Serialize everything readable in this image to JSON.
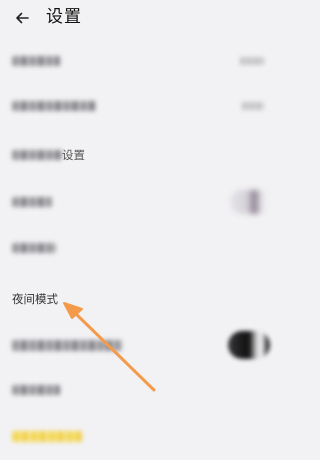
{
  "header": {
    "back_icon": "arrow-left-icon",
    "title": "设置"
  },
  "rows": [
    {
      "label_visible": ""
    },
    {
      "label_visible": ""
    },
    {
      "label_visible": "设置"
    },
    {
      "label_visible": ""
    },
    {
      "label_visible": ""
    },
    {
      "label_visible": "夜间模式"
    },
    {
      "label_visible": ""
    },
    {
      "label_visible": ""
    },
    {
      "label_visible": ""
    }
  ],
  "annotation": {
    "arrow_color": "#f39a4b",
    "points_to": "夜间模式"
  },
  "colors": {
    "background": "#f2f2f4",
    "accent_yellow": "#f4d33e"
  }
}
